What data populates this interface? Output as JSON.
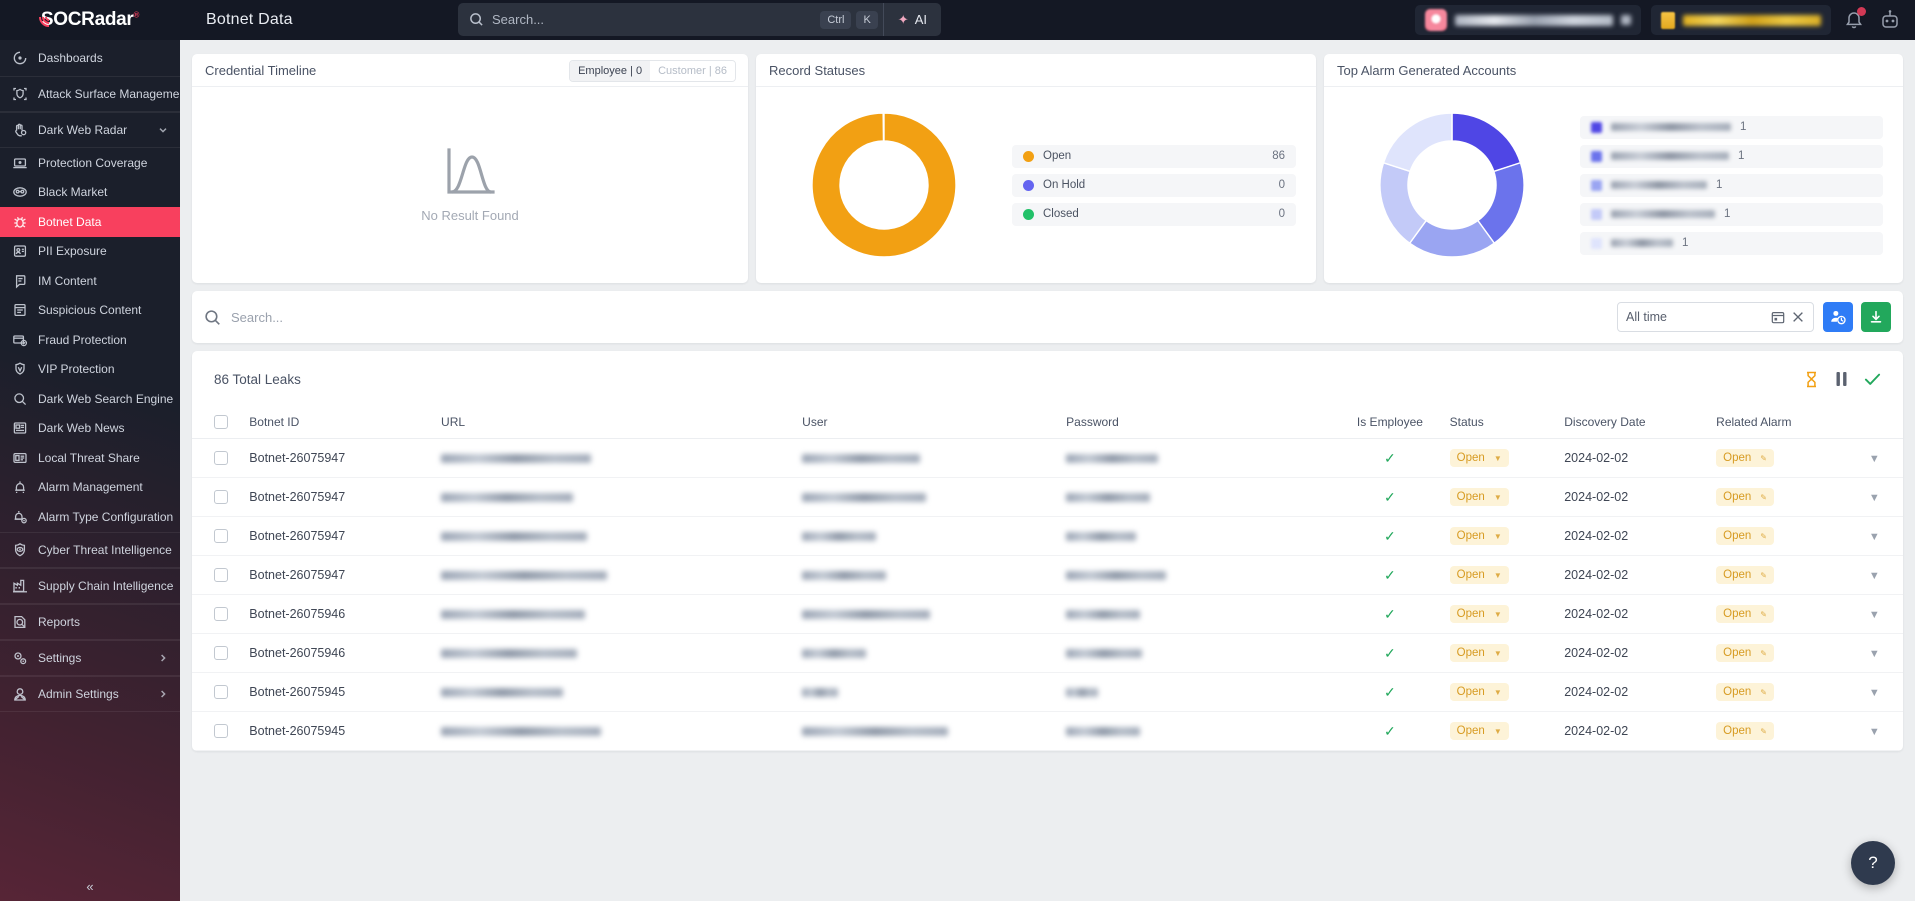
{
  "header": {
    "logo_text": "SOCRadar",
    "logo_registered": "®",
    "page_title": "Botnet Data",
    "search_placeholder": "Search...",
    "search_value": "",
    "kbd_ctrl": "Ctrl",
    "kbd_key": "K",
    "ai_label": "AI",
    "org_name_redacted": "██████████████",
    "doc_badge_redacted": "██████ ███████",
    "accent_red": "#f8405e"
  },
  "sidebar": {
    "items": [
      {
        "label": "Dashboards",
        "icon": "dashboard-icon",
        "type": "big",
        "expandable": false
      },
      {
        "label": "Attack Surface Management",
        "icon": "shield-scan-icon",
        "type": "group",
        "expandable": true,
        "chevron": "›"
      },
      {
        "label": "Dark Web Radar",
        "icon": "hand-radar-icon",
        "type": "group",
        "expandable": true,
        "chevron": "⌄",
        "expanded": true
      },
      {
        "label": "Protection Coverage",
        "icon": "laptop-icon",
        "type": "sub",
        "expandable": false
      },
      {
        "label": "Black Market",
        "icon": "mask-icon",
        "type": "sub",
        "expandable": false
      },
      {
        "label": "Botnet Data",
        "icon": "bug-icon",
        "type": "sub",
        "expandable": false,
        "active": true
      },
      {
        "label": "PII Exposure",
        "icon": "id-card-icon",
        "type": "sub",
        "expandable": false
      },
      {
        "label": "IM Content",
        "icon": "chat-icon",
        "type": "sub",
        "expandable": false
      },
      {
        "label": "Suspicious Content",
        "icon": "file-warning-icon",
        "type": "sub",
        "expandable": false
      },
      {
        "label": "Fraud Protection",
        "icon": "card-fraud-icon",
        "type": "sub",
        "expandable": false
      },
      {
        "label": "VIP Protection",
        "icon": "vip-shield-icon",
        "type": "sub",
        "expandable": false
      },
      {
        "label": "Dark Web Search Engine",
        "icon": "search-icon",
        "type": "sub",
        "expandable": false
      },
      {
        "label": "Dark Web News",
        "icon": "news-icon",
        "type": "sub",
        "expandable": false
      },
      {
        "label": "Local Threat Share",
        "icon": "share-board-icon",
        "type": "sub",
        "expandable": false
      },
      {
        "label": "Alarm Management",
        "icon": "alarm-icon",
        "type": "sub",
        "expandable": false
      },
      {
        "label": "Alarm Type Configuration",
        "icon": "alarm-gear-icon",
        "type": "sub",
        "expandable": false
      },
      {
        "label": "Cyber Threat Intelligence",
        "icon": "eye-shield-icon",
        "type": "group",
        "expandable": true,
        "chevron": "›"
      },
      {
        "label": "Supply Chain Intelligence",
        "icon": "factory-icon",
        "type": "group",
        "expandable": true,
        "chevron": "›"
      },
      {
        "label": "Reports",
        "icon": "report-search-icon",
        "type": "group",
        "expandable": false
      },
      {
        "label": "Settings",
        "icon": "gears-icon",
        "type": "group",
        "expandable": true,
        "chevron": "›"
      },
      {
        "label": "Admin Settings",
        "icon": "admin-user-icon",
        "type": "group",
        "expandable": true,
        "chevron": "›"
      }
    ],
    "collapse_glyph": "«"
  },
  "cards": {
    "credential_timeline": {
      "title": "Credential Timeline",
      "toggle": [
        {
          "label": "Employee | 0",
          "selected": true
        },
        {
          "label": "Customer | 86",
          "selected": false
        }
      ],
      "empty_text": "No Result Found"
    },
    "record_statuses": {
      "title": "Record Statuses"
    },
    "top_alarm_accounts": {
      "title": "Top Alarm Generated Accounts"
    }
  },
  "chart_data": [
    {
      "type": "pie",
      "title": "Record Statuses",
      "legend_position": "right",
      "labels": [
        "Open",
        "On Hold",
        "Closed"
      ],
      "values": [
        86,
        0,
        0
      ],
      "colors": [
        "#f2a013",
        "#6464f0",
        "#22c169"
      ]
    },
    {
      "type": "pie",
      "title": "Top Alarm Generated Accounts",
      "legend_position": "right",
      "labels": [
        "██████████",
        "██████████",
        "████████",
        "█████████",
        "██████"
      ],
      "values": [
        1,
        1,
        1,
        1,
        1
      ],
      "colors": [
        "#4f46e5",
        "#6b73ec",
        "#9aa5f2",
        "#c3caf8",
        "#dfe4fc"
      ]
    }
  ],
  "toolbar": {
    "search_placeholder": "Search...",
    "search_value": "",
    "date_value": "All time",
    "calendar_icon": "calendar-icon",
    "clear_icon": "close-icon",
    "assign_button_icon": "user-clock-icon",
    "download_button_icon": "download-icon",
    "blue": "#2f7cf6",
    "green": "#22a85c"
  },
  "table": {
    "total_label": "86 Total Leaks",
    "header_actions": [
      {
        "icon": "hourglass-icon",
        "color": "#f2a013"
      },
      {
        "icon": "pause-icon",
        "color": "#5b6270"
      },
      {
        "icon": "check-icon",
        "color": "#22a85c"
      }
    ],
    "columns": [
      "Botnet ID",
      "URL",
      "User",
      "Password",
      "Is Employee",
      "Status",
      "Discovery Date",
      "Related Alarm"
    ],
    "rows": [
      {
        "id": "Botnet-26075947",
        "url": "",
        "user": "",
        "password": "",
        "is_employee": "✓",
        "status": "Open",
        "discovery_date": "2024-02-02",
        "related_alarm": "Open"
      },
      {
        "id": "Botnet-26075947",
        "url": "",
        "user": "",
        "password": "",
        "is_employee": "✓",
        "status": "Open",
        "discovery_date": "2024-02-02",
        "related_alarm": "Open"
      },
      {
        "id": "Botnet-26075947",
        "url": "",
        "user": "",
        "password": "",
        "is_employee": "✓",
        "status": "Open",
        "discovery_date": "2024-02-02",
        "related_alarm": "Open"
      },
      {
        "id": "Botnet-26075947",
        "url": "",
        "user": "",
        "password": "",
        "is_employee": "✓",
        "status": "Open",
        "discovery_date": "2024-02-02",
        "related_alarm": "Open"
      },
      {
        "id": "Botnet-26075946",
        "url": "",
        "user": "",
        "password": "",
        "is_employee": "✓",
        "status": "Open",
        "discovery_date": "2024-02-02",
        "related_alarm": "Open"
      },
      {
        "id": "Botnet-26075946",
        "url": "",
        "user": "",
        "password": "",
        "is_employee": "✓",
        "status": "Open",
        "discovery_date": "2024-02-02",
        "related_alarm": "Open"
      },
      {
        "id": "Botnet-26075945",
        "url": "",
        "user": "",
        "password": "",
        "is_employee": "✓",
        "status": "Open",
        "discovery_date": "2024-02-02",
        "related_alarm": "Open"
      },
      {
        "id": "Botnet-26075945",
        "url": "",
        "user": "",
        "password": "",
        "is_employee": "✓",
        "status": "Open",
        "discovery_date": "2024-02-02",
        "related_alarm": "Open"
      }
    ]
  },
  "help": {
    "icon": "question-icon",
    "glyph": "?"
  }
}
